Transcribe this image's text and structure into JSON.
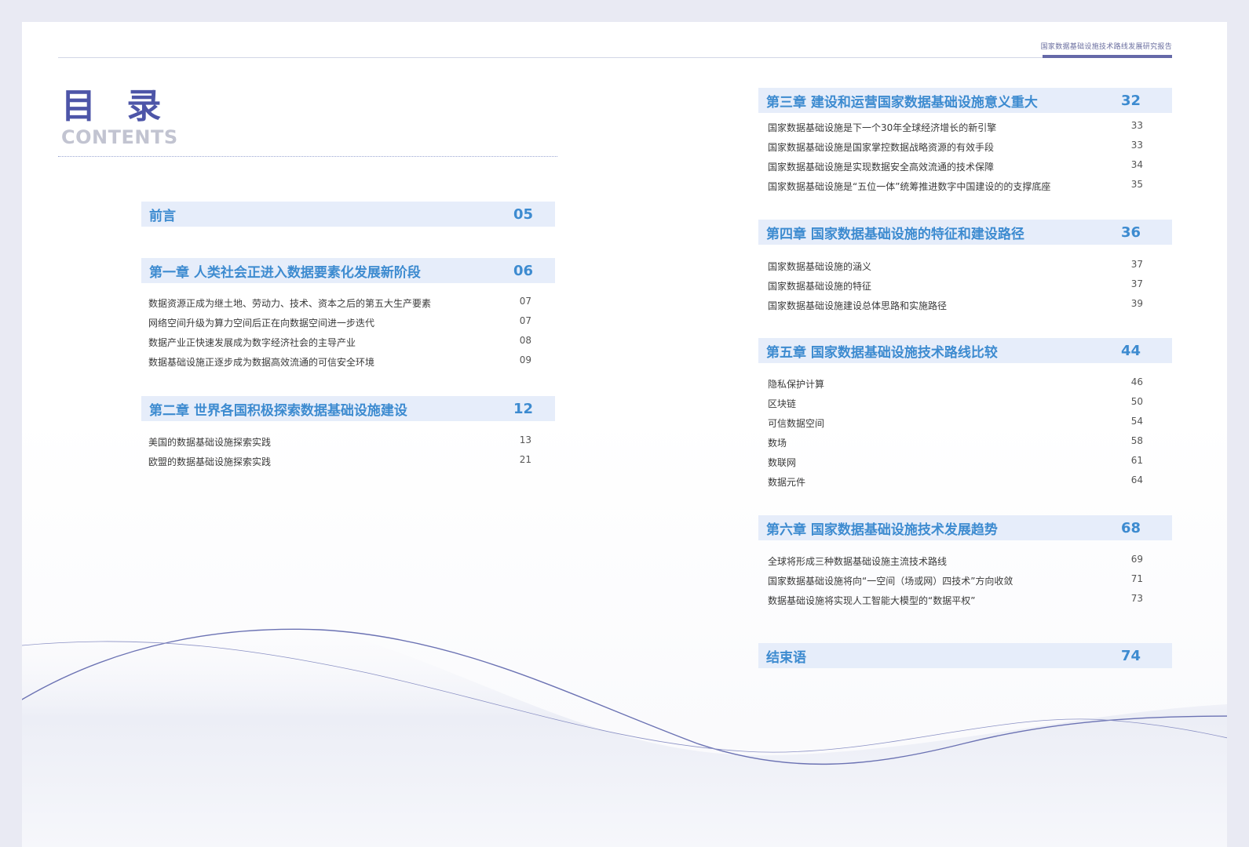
{
  "header": {
    "text": "国家数据基础设施技术路线发展研究报告"
  },
  "title": {
    "cn": "目 录",
    "en": "CONTENTS"
  },
  "left": {
    "preface": {
      "label": "前言",
      "page": "05"
    },
    "ch1": {
      "label": "第一章 人类社会正进入数据要素化发展新阶段",
      "page": "06",
      "items": [
        {
          "label": "数据资源正成为继土地、劳动力、技术、资本之后的第五大生产要素",
          "page": "07"
        },
        {
          "label": "网络空间升级为算力空间后正在向数据空间进一步迭代",
          "page": "07"
        },
        {
          "label": "数据产业正快速发展成为数字经济社会的主导产业",
          "page": "08"
        },
        {
          "label": "数据基础设施正逐步成为数据高效流通的可信安全环境",
          "page": "09"
        }
      ]
    },
    "ch2": {
      "label": "第二章 世界各国积极探索数据基础设施建设",
      "page": "12",
      "items": [
        {
          "label": "美国的数据基础设施探索实践",
          "page": "13"
        },
        {
          "label": "欧盟的数据基础设施探索实践",
          "page": "21"
        }
      ]
    }
  },
  "right": {
    "ch3": {
      "label": "第三章 建设和运营国家数据基础设施意义重大",
      "page": "32",
      "items": [
        {
          "label": "国家数据基础设施是下一个30年全球经济增长的新引擎",
          "page": "33"
        },
        {
          "label": "国家数据基础设施是国家掌控数据战略资源的有效手段",
          "page": "33"
        },
        {
          "label": "国家数据基础设施是实现数据安全高效流通的技术保障",
          "page": "34"
        },
        {
          "label": "国家数据基础设施是“五位一体”统筹推进数字中国建设的的支撑底座",
          "page": "35"
        }
      ]
    },
    "ch4": {
      "label": "第四章 国家数据基础设施的特征和建设路径",
      "page": "36",
      "items": [
        {
          "label": "国家数据基础设施的涵义",
          "page": "37"
        },
        {
          "label": "国家数据基础设施的特征",
          "page": "37"
        },
        {
          "label": "国家数据基础设施建设总体思路和实施路径",
          "page": "39"
        }
      ]
    },
    "ch5": {
      "label": "第五章 国家数据基础设施技术路线比较",
      "page": "44",
      "items": [
        {
          "label": "隐私保护计算",
          "page": "46"
        },
        {
          "label": "区块链",
          "page": "50"
        },
        {
          "label": "可信数据空间",
          "page": "54"
        },
        {
          "label": "数场",
          "page": "58"
        },
        {
          "label": "数联网",
          "page": "61"
        },
        {
          "label": "数据元件",
          "page": "64"
        }
      ]
    },
    "ch6": {
      "label": "第六章 国家数据基础设施技术发展趋势",
      "page": "68",
      "items": [
        {
          "label": "全球将形成三种数据基础设施主流技术路线",
          "page": "69"
        },
        {
          "label": "国家数据基础设施将向“一空间（场或网）四技术”方向收敛",
          "page": "71"
        },
        {
          "label": "数据基础设施将实现人工智能大模型的“数据平权”",
          "page": "73"
        }
      ]
    },
    "conclusion": {
      "label": "结束语",
      "page": "74"
    }
  }
}
